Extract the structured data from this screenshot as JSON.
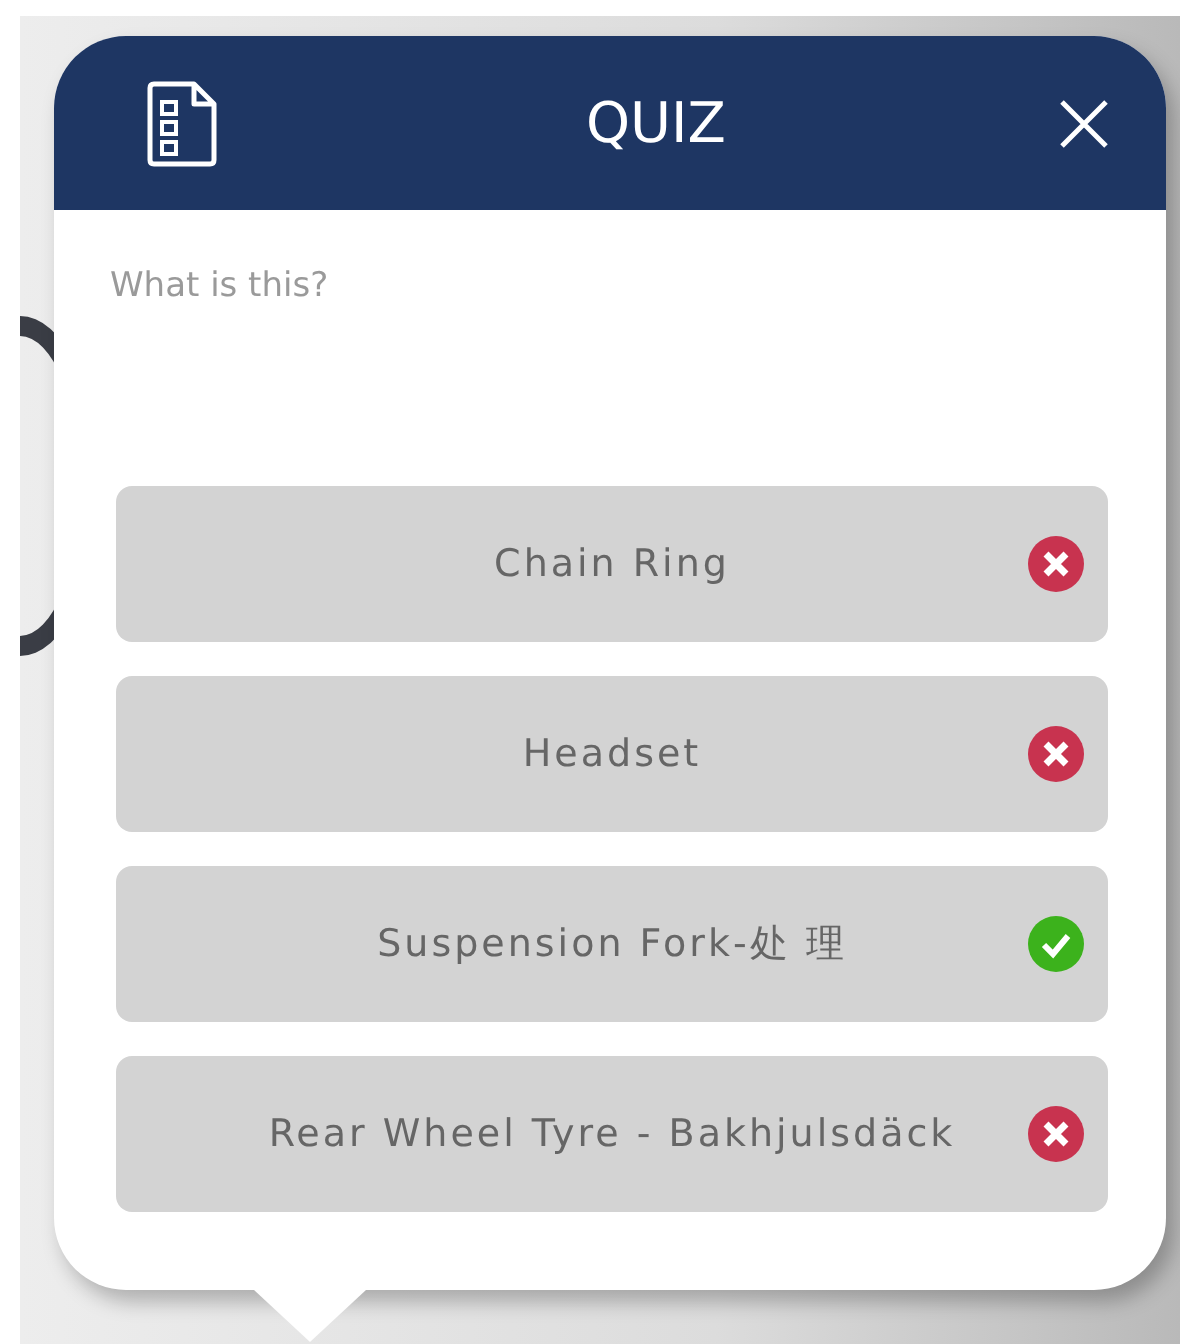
{
  "dialog": {
    "title": "QUIZ",
    "question": "What is this?"
  },
  "answers": [
    {
      "label": "Chain Ring",
      "correct": false
    },
    {
      "label": "Headset",
      "correct": false
    },
    {
      "label": "Suspension Fork-处 理",
      "correct": true
    },
    {
      "label": "Rear Wheel Tyre - Bakhjulsdäck",
      "correct": false
    }
  ]
}
